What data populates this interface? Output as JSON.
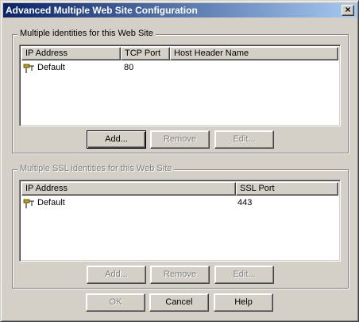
{
  "window": {
    "title": "Advanced Multiple Web Site Configuration",
    "close_glyph": "×"
  },
  "identities": {
    "label": "Multiple identities for this Web Site",
    "columns": [
      "IP Address",
      "TCP Port",
      "Host Header Name"
    ],
    "rows": [
      {
        "ip": "Default",
        "port": "80",
        "host": ""
      }
    ],
    "buttons": {
      "add": "Add...",
      "remove": "Remove",
      "edit": "Edit..."
    }
  },
  "ssl": {
    "label": "Multiple SSL identities for this Web Site",
    "columns": [
      "IP Address",
      "SSL Port"
    ],
    "rows": [
      {
        "ip": "Default",
        "port": "443"
      }
    ],
    "buttons": {
      "add": "Add...",
      "remove": "Remove",
      "edit": "Edit..."
    }
  },
  "footer": {
    "ok": "OK",
    "cancel": "Cancel",
    "help": "Help"
  },
  "icons": {
    "row_icon": "network-connector-icon"
  }
}
